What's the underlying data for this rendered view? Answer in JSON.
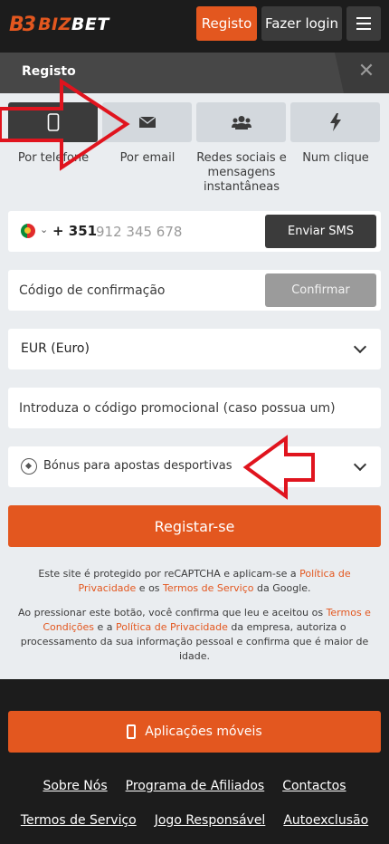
{
  "header": {
    "logo_mark": "B3",
    "logo_biz": "BIZ",
    "logo_bet": "BET",
    "register_label": "Registo",
    "login_label": "Fazer login"
  },
  "modal": {
    "title": "Registo",
    "close_glyph": "✕"
  },
  "tabs": [
    {
      "label": "Por telefone",
      "icon": "phone-icon"
    },
    {
      "label": "Por email",
      "icon": "envelope-icon"
    },
    {
      "label": "Redes sociais e mensagens instantâneas",
      "icon": "users-icon"
    },
    {
      "label": "Num clique",
      "icon": "bolt-icon"
    }
  ],
  "phone": {
    "country_code": "+ 351",
    "placeholder": "912 345 678",
    "send_sms_label": "Enviar SMS"
  },
  "confirmation": {
    "placeholder": "Código de confirmação",
    "confirm_label": "Confirmar"
  },
  "currency": {
    "value": "EUR (Euro)"
  },
  "promo": {
    "placeholder": "Introduza o código promocional (caso possua um)"
  },
  "bonus": {
    "label": "Bónus para apostas desportivas"
  },
  "register_button": "Registar-se",
  "legal": {
    "recaptcha_prefix": "Este site é protegido por reCAPTCHA e aplicam-se a ",
    "privacy_policy": "Política de Privacidade",
    "recaptcha_middle": " e os ",
    "terms_of_service": "Termos de Serviço",
    "recaptcha_suffix": " da Google.",
    "consent_prefix": "Ao pressionar este botão, você confirma que leu e aceitou os ",
    "terms_conditions": "Termos e Condições",
    "consent_middle": " e a ",
    "privacy_policy_2": "Política de Privacidade",
    "consent_suffix": " da empresa, autoriza o processamento da sua informação pessoal e confirma que é maior de idade."
  },
  "footer": {
    "apps_label": "Aplicações móveis",
    "links_row1": [
      "Sobre Nós",
      "Programa de Afiliados",
      "Contactos"
    ],
    "links_row2": [
      "Termos de Serviço",
      "Jogo Responsável",
      "Autoexclusão"
    ]
  },
  "colors": {
    "accent": "#e3571f",
    "dark": "#1c1c1c",
    "panel": "#eaedf0",
    "arrow": "#e0141e"
  }
}
